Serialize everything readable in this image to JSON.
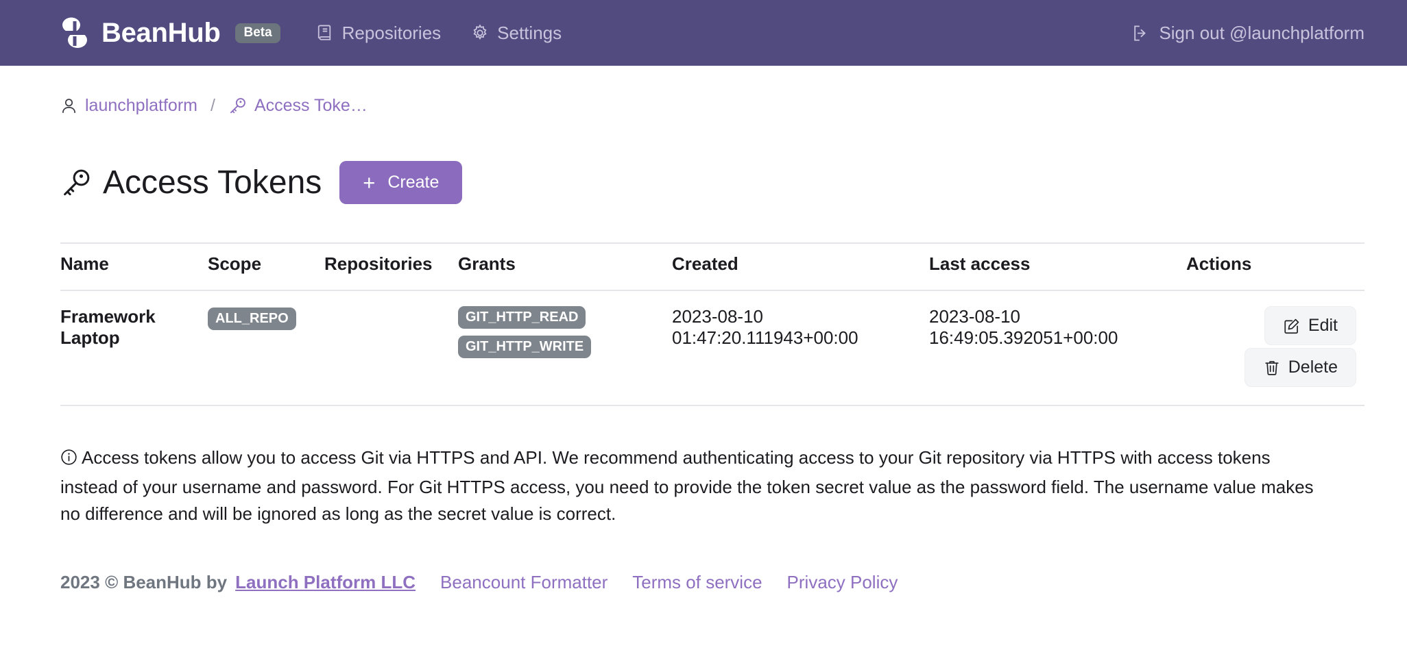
{
  "navbar": {
    "brand_name": "BeanHub",
    "beta_label": "Beta",
    "links": [
      {
        "label": "Repositories",
        "icon": "book-icon"
      },
      {
        "label": "Settings",
        "icon": "gear-icon"
      }
    ],
    "signout_label": "Sign out @launchplatform",
    "signout_icon": "box-arrow-right-icon",
    "bg_color": "#524b7f",
    "text_color": "#c9c3dd"
  },
  "breadcrumb": {
    "user": "launchplatform",
    "user_icon": "person-icon",
    "separator": "/",
    "current": "Access Toke…",
    "current_icon": "key-icon",
    "link_color": "#8e6fc0"
  },
  "page": {
    "title": "Access Tokens",
    "title_icon": "key-icon",
    "create_label": "Create",
    "create_icon": "plus-icon",
    "create_color": "#8b6bbd"
  },
  "table": {
    "columns": [
      "Name",
      "Scope",
      "Repositories",
      "Grants",
      "Created",
      "Last access",
      "Actions"
    ],
    "rows": [
      {
        "name": "Framework Laptop",
        "scope": "ALL_REPO",
        "repositories": "",
        "grants": [
          "GIT_HTTP_READ",
          "GIT_HTTP_WRITE"
        ],
        "created": "2023-08-10 01:47:20.111943+00:00",
        "created_date": "2023-08-10",
        "created_time": "01:47:20.111943+00:00",
        "last_access": "2023-08-10 16:49:05.392051+00:00",
        "last_access_date": "2023-08-10",
        "last_access_time": "16:49:05.392051+00:00",
        "edit_label": "Edit",
        "edit_icon": "pencil-square-icon",
        "delete_label": "Delete",
        "delete_icon": "trash-icon"
      }
    ],
    "badge_color": "#7f858c"
  },
  "info": {
    "icon": "info-circle-icon",
    "text": "Access tokens allow you to access Git via HTTPS and API. We recommend authenticating access to your Git repository via HTTPS with access tokens instead of your username and password. For Git HTTPS access, you need to provide the token secret value as the password field. The username value makes no difference and will be ignored as long as the secret value is correct."
  },
  "footer": {
    "copyright": "2023 © BeanHub by",
    "company": "Launch Platform LLC",
    "links": [
      "Beancount Formatter",
      "Terms of service",
      "Privacy Policy"
    ]
  }
}
